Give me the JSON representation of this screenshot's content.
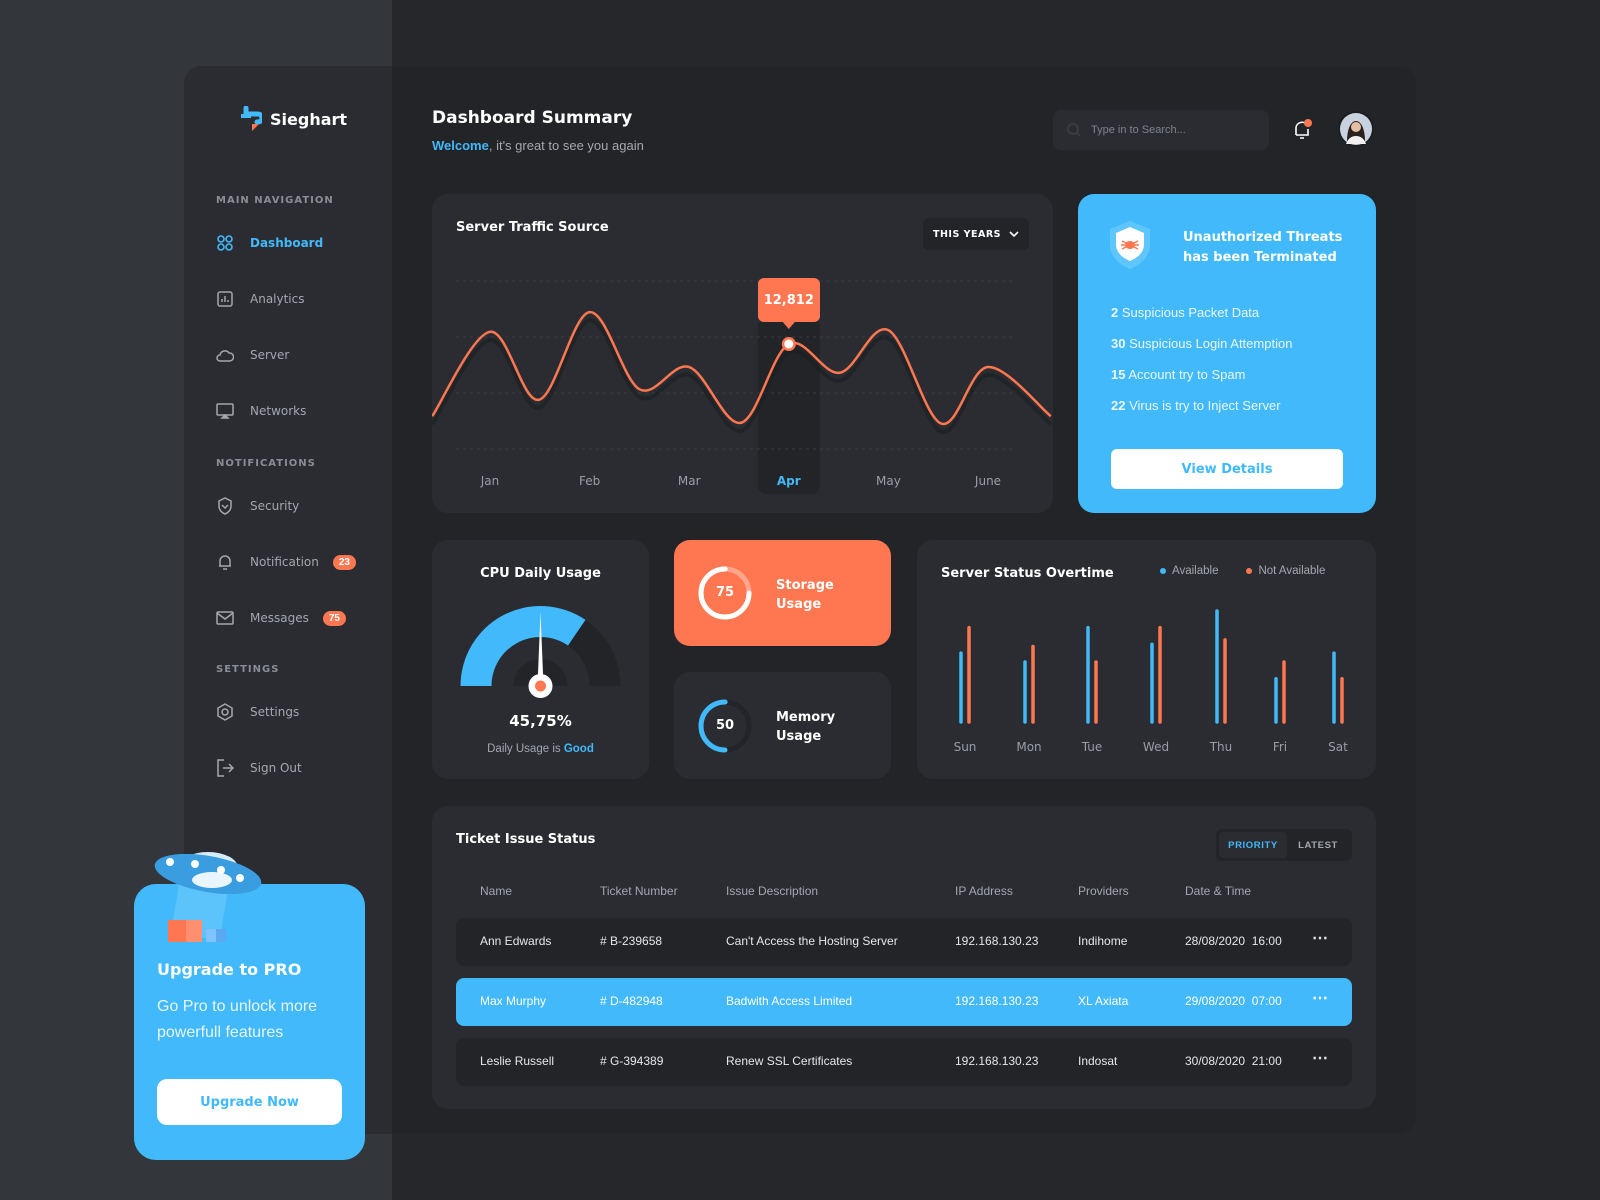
{
  "brand": {
    "name": "Sieghart"
  },
  "sidebar": {
    "sections": [
      {
        "title": "MAIN NAVIGATION",
        "items": [
          {
            "label": "Dashboard",
            "icon": "grid-icon",
            "active": true
          },
          {
            "label": "Analytics",
            "icon": "bar-chart-icon"
          },
          {
            "label": "Server",
            "icon": "cloud-icon"
          },
          {
            "label": "Networks",
            "icon": "monitor-icon"
          }
        ]
      },
      {
        "title": "NOTIFICATIONS",
        "items": [
          {
            "label": "Security",
            "icon": "shield-icon"
          },
          {
            "label": "Notification",
            "icon": "bell-icon",
            "badge": "23"
          },
          {
            "label": "Messages",
            "icon": "mail-icon",
            "badge": "75"
          }
        ]
      },
      {
        "title": "SETTINGS",
        "items": [
          {
            "label": "Settings",
            "icon": "gear-icon"
          },
          {
            "label": "Sign Out",
            "icon": "sign-out-icon"
          }
        ]
      }
    ],
    "upgrade": {
      "title": "Upgrade to PRO",
      "text": "Go Pro to unlock more powerfull features",
      "button": "Upgrade Now"
    }
  },
  "header": {
    "title": "Dashboard Summary",
    "welcome": "Welcome",
    "subtitle": ", it's great to see you again",
    "search_placeholder": "Type in to Search...",
    "notification_dot": true
  },
  "colors": {
    "blue": "#41b9fb",
    "orange": "#ff7750",
    "bg": "#222428",
    "card": "#2a2c31"
  },
  "traffic": {
    "title": "Server Traffic Source",
    "period": "THIS YEARS",
    "tooltip": "12,812",
    "chart_data": {
      "type": "line",
      "categories": [
        "Jan",
        "Feb",
        "Mar",
        "Apr",
        "May",
        "June"
      ],
      "highlighted": "Apr",
      "x": [
        -0.58,
        0,
        0.49,
        1,
        1.5,
        2,
        2.52,
        3,
        3.51,
        4,
        4.53,
        5,
        5.63
      ],
      "y": [
        4000,
        14300,
        6000,
        16700,
        7300,
        10000,
        3200,
        12812,
        9300,
        14500,
        3100,
        10000,
        4000
      ],
      "ylim": [
        0,
        20500
      ],
      "grid": true
    }
  },
  "threats": {
    "title_line1": "Unauthorized Threats",
    "title_line2": "has  been Terminated",
    "items": [
      {
        "count": "2",
        "text": "Suspicious Packet Data"
      },
      {
        "count": "30",
        "text": "Suspicious Login Attemption"
      },
      {
        "count": "15",
        "text": "Account try to Spam"
      },
      {
        "count": "22",
        "text": "Virus is try to Inject Server"
      }
    ],
    "button": "View Details"
  },
  "cpu": {
    "title": "CPU Daily Usage",
    "value": "45,75%",
    "caption": "Daily Usage is ",
    "status": "Good",
    "gauge_fill": 0.69
  },
  "storage": {
    "value": "75",
    "percent": 75,
    "label1": "Storage",
    "label2": "Usage"
  },
  "memory": {
    "value": "50",
    "percent": 50,
    "label1": "Memory",
    "label2": "Usage"
  },
  "server_status": {
    "title": "Server Status Overtime",
    "chart_data": {
      "type": "bar",
      "categories": [
        "Sun",
        "Mon",
        "Tue",
        "Wed",
        "Thu",
        "Fri",
        "Sat"
      ],
      "series": [
        {
          "name": "Available",
          "color": "#41b9fb",
          "values": [
            62,
            54,
            85,
            70,
            100,
            39,
            62
          ]
        },
        {
          "name": "Not Available",
          "color": "#ff7750",
          "values": [
            85,
            68,
            54,
            85,
            74,
            54,
            39
          ]
        }
      ],
      "legend": "top-right"
    }
  },
  "tickets": {
    "title": "Ticket Issue Status",
    "tabs": [
      "PRIORITY",
      "LATEST"
    ],
    "columns": [
      "Name",
      "Ticket Number",
      "Issue Description",
      "IP Address",
      "Providers",
      "Date & Time"
    ],
    "rows": [
      {
        "name": "Ann Edwards",
        "ticket": "# B-239658",
        "issue": "Can't Access the Hosting Server",
        "ip": "192.168.130.23",
        "provider": "Indihome",
        "date": "28/08/2020  16:00"
      },
      {
        "name": "Max Murphy",
        "ticket": "# D-482948",
        "issue": "Badwith Access Limited",
        "ip": "192.168.130.23",
        "provider": "XL Axiata",
        "date": "29/08/2020  07:00",
        "selected": true
      },
      {
        "name": "Leslie Russell",
        "ticket": "# G-394389",
        "issue": "Renew SSL Certificates",
        "ip": "192.168.130.23",
        "provider": "Indosat",
        "date": "30/08/2020  21:00"
      }
    ]
  }
}
